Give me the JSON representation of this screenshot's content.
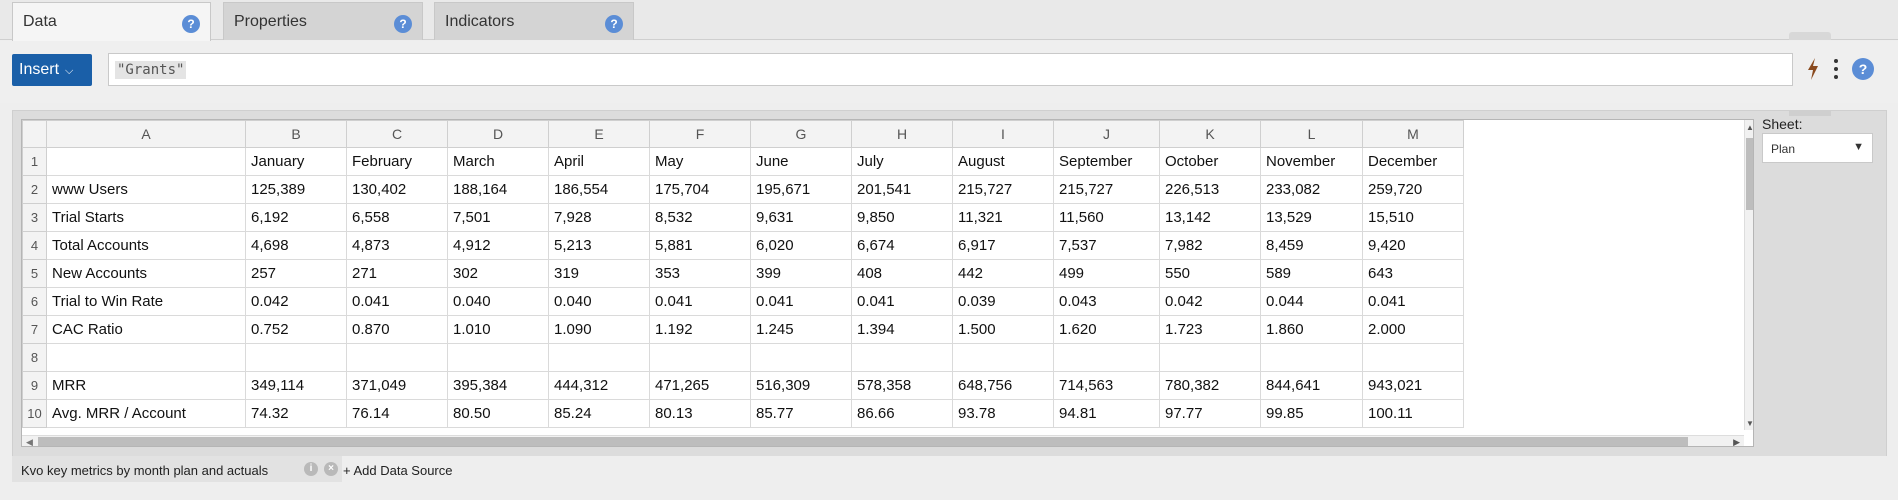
{
  "tabs": [
    {
      "label": "Data",
      "help": "?"
    },
    {
      "label": "Properties",
      "help": "?"
    },
    {
      "label": "Indicators",
      "help": "?"
    }
  ],
  "toolbar": {
    "insert_label": "Insert",
    "insert_chevron": "⌵",
    "formula_value": "\"Grants\"",
    "help": "?"
  },
  "grid": {
    "columns": [
      "",
      "A",
      "B",
      "C",
      "D",
      "E",
      "F",
      "G",
      "H",
      "I",
      "J",
      "K",
      "L",
      "M"
    ],
    "rows": [
      [
        "1",
        "",
        "January",
        "February",
        "March",
        "April",
        "May",
        "June",
        "July",
        "August",
        "September",
        "October",
        "November",
        "December"
      ],
      [
        "2",
        "www Users",
        "125,389",
        "130,402",
        "188,164",
        "186,554",
        "175,704",
        "195,671",
        "201,541",
        "215,727",
        "215,727",
        "226,513",
        "233,082",
        "259,720"
      ],
      [
        "3",
        "Trial Starts",
        "6,192",
        "6,558",
        "7,501",
        "7,928",
        "8,532",
        "9,631",
        "9,850",
        "11,321",
        "11,560",
        "13,142",
        "13,529",
        "15,510"
      ],
      [
        "4",
        "Total Accounts",
        "4,698",
        "4,873",
        "4,912",
        "5,213",
        "5,881",
        "6,020",
        "6,674",
        "6,917",
        "7,537",
        "7,982",
        "8,459",
        "9,420"
      ],
      [
        "5",
        "New Accounts",
        "257",
        "271",
        "302",
        "319",
        "353",
        "399",
        "408",
        "442",
        "499",
        "550",
        "589",
        "643"
      ],
      [
        "6",
        "Trial to Win Rate",
        "0.042",
        "0.041",
        "0.040",
        "0.040",
        "0.041",
        "0.041",
        "0.041",
        "0.039",
        "0.043",
        "0.042",
        "0.044",
        "0.041"
      ],
      [
        "7",
        "CAC Ratio",
        "0.752",
        "0.870",
        "1.010",
        "1.090",
        "1.192",
        "1.245",
        "1.394",
        "1.500",
        "1.620",
        "1.723",
        "1.860",
        "2.000"
      ],
      [
        "8",
        "",
        "",
        "",
        "",
        "",
        "",
        "",
        "",
        "",
        "",
        "",
        "",
        ""
      ],
      [
        "9",
        "MRR",
        "349,114",
        "371,049",
        "395,384",
        "444,312",
        "471,265",
        "516,309",
        "578,358",
        "648,756",
        "714,563",
        "780,382",
        "844,641",
        "943,021"
      ],
      [
        "10",
        "Avg. MRR / Account",
        "74.32",
        "76.14",
        "80.50",
        "85.24",
        "80.13",
        "85.77",
        "86.66",
        "93.78",
        "94.81",
        "97.77",
        "99.85",
        "100.11"
      ]
    ]
  },
  "sheet": {
    "label": "Sheet:",
    "selected": "Plan",
    "arrow": "▼"
  },
  "sources": {
    "chip_label": "Kvo key metrics by month plan and actuals",
    "info": "i",
    "close": "×",
    "add_label": "+ Add Data Source"
  }
}
